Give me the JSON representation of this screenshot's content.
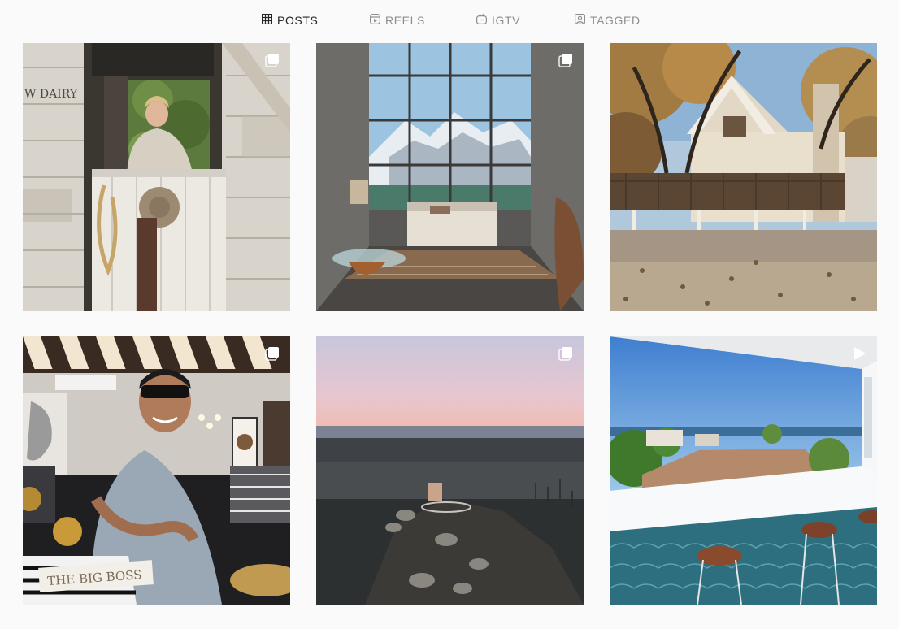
{
  "tabs": [
    {
      "label": "POSTS",
      "icon": "grid-icon",
      "active": true
    },
    {
      "label": "REELS",
      "icon": "reels-icon",
      "active": false
    },
    {
      "label": "IGTV",
      "icon": "igtv-icon",
      "active": false
    },
    {
      "label": "TAGGED",
      "icon": "tagged-icon",
      "active": false
    }
  ],
  "posts": [
    {
      "type": "carousel",
      "badge_icon": "carousel-icon",
      "sign_text": "W DAIRY"
    },
    {
      "type": "carousel",
      "badge_icon": "carousel-icon"
    },
    {
      "type": "image"
    },
    {
      "type": "carousel",
      "badge_icon": "carousel-icon",
      "sign_text": "THE BIG BOSS"
    },
    {
      "type": "carousel",
      "badge_icon": "carousel-icon"
    },
    {
      "type": "video",
      "badge_icon": "play-icon"
    }
  ],
  "colors": {
    "background": "#fafafa",
    "tab_active": "#262626",
    "tab_inactive": "#8e8e8e"
  }
}
